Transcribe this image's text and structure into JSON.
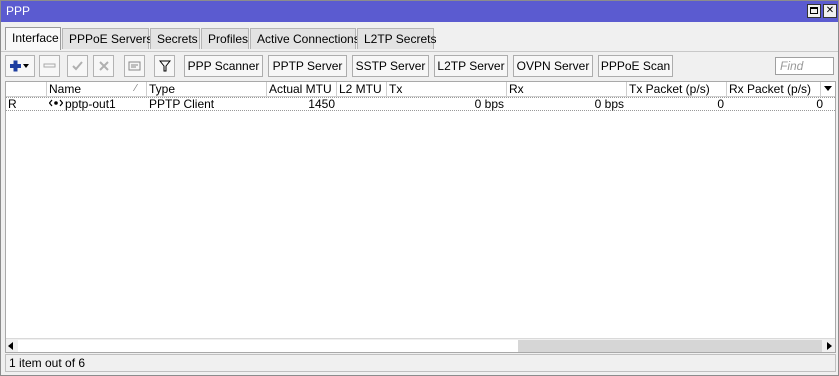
{
  "window": {
    "title": "PPP"
  },
  "tabs": [
    {
      "label": "Interface"
    },
    {
      "label": "PPPoE Servers"
    },
    {
      "label": "Secrets"
    },
    {
      "label": "Profiles"
    },
    {
      "label": "Active Connections"
    },
    {
      "label": "L2TP Secrets"
    }
  ],
  "toolbar": {
    "buttons": [
      {
        "label": "PPP Scanner"
      },
      {
        "label": "PPTP Server"
      },
      {
        "label": "SSTP Server"
      },
      {
        "label": "L2TP Server"
      },
      {
        "label": "OVPN Server"
      },
      {
        "label": "PPPoE Scan"
      }
    ],
    "find_placeholder": "Find"
  },
  "table": {
    "columns": [
      "Name",
      "Type",
      "Actual MTU",
      "L2 MTU",
      "Tx",
      "Rx",
      "Tx Packet (p/s)",
      "Rx Packet (p/s)"
    ],
    "rows": [
      {
        "flag": "R",
        "name": "pptp-out1",
        "type": "PPTP Client",
        "actual_mtu": "1450",
        "l2_mtu": "",
        "tx": "0 bps",
        "rx": "0 bps",
        "tx_packet": "0",
        "rx_packet": "0"
      }
    ]
  },
  "status": {
    "text": "1 item out of 6"
  },
  "colors": {
    "titlebar": "#5b5bd0",
    "add_icon": "#1f3fa0"
  },
  "icons": [
    "add-icon",
    "remove-icon",
    "enable-icon",
    "disable-icon",
    "comment-icon",
    "filter-icon",
    "interface-icon",
    "sort-icon"
  ]
}
